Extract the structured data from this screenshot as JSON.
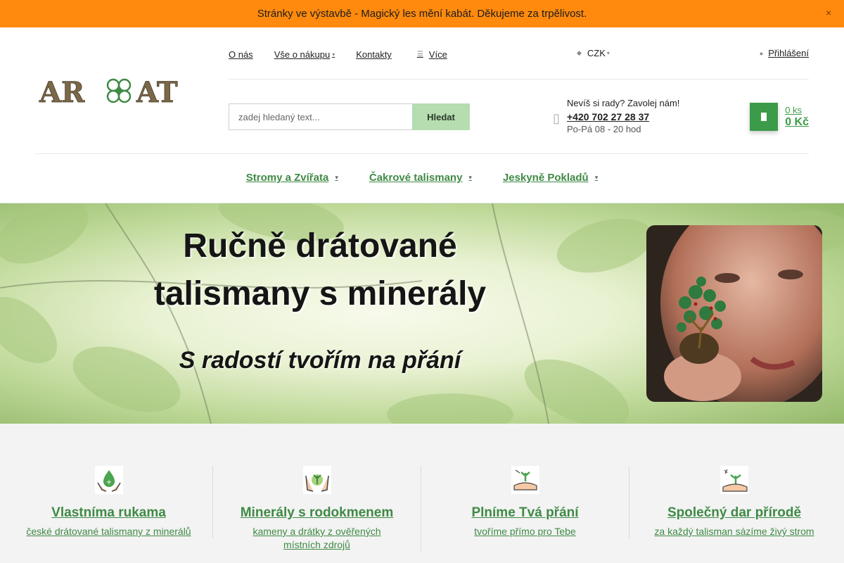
{
  "banner": {
    "text": "Stránky ve výstavbě - Magický les mění kabát. Děkujeme za trpělivost.",
    "close_label": "×"
  },
  "header": {
    "logo_text": "AR AT",
    "top_nav": [
      {
        "label": "O nás",
        "has_dropdown": false
      },
      {
        "label": "Vše o nákupu",
        "has_dropdown": true
      },
      {
        "label": "Kontakty",
        "has_dropdown": false
      },
      {
        "label": "Více",
        "has_dropdown": true
      }
    ],
    "currency": "CZK",
    "login_label": "Přihlášení",
    "search": {
      "placeholder": "zadej hledaný text...",
      "button_label": "Hledat"
    },
    "contact": {
      "prompt": "Nevíš si rady? Zavolej nám!",
      "phone": "+420 702 27 28 37",
      "hours": "Po-Pá 08 - 20 hod"
    },
    "cart": {
      "count_label": "0 ks",
      "price_label": "0 Kč"
    },
    "categories": [
      {
        "label": "Stromy a Zvířata"
      },
      {
        "label": "Čakrové talismany"
      },
      {
        "label": "Jeskyně Pokladů"
      }
    ]
  },
  "hero": {
    "title_line1": "Ručně drátované",
    "title_line2": "talismany s minerály",
    "subtitle": "S radostí tvořím na přání"
  },
  "features": [
    {
      "title": "Vlastníma rukama",
      "text": "české drátované talismany z minerálů",
      "icon": "hands-drop-icon"
    },
    {
      "title": "Minerály s rodokmenem",
      "text": "kameny a drátky z ověřených místních zdrojů",
      "icon": "hands-plant-icon"
    },
    {
      "title": "Plníme Tvá přání",
      "text": "tvoříme přímo pro Tebe",
      "icon": "hand-seedling-icon"
    },
    {
      "title": "Společný dar přírodě",
      "text": "za každý talisman sázíme živý strom",
      "icon": "hand-sprout-icon"
    }
  ],
  "colors": {
    "accent_green": "#3f8a45",
    "banner_orange": "#ff8a0d",
    "cart_green": "#3c9b48"
  }
}
